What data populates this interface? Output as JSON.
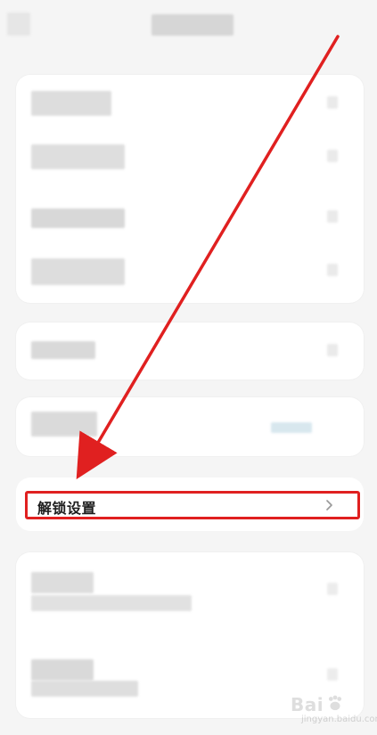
{
  "unlock_settings": {
    "label": "解锁设置"
  },
  "watermark": {
    "brand": "Bai",
    "site": "jingyan.baidu.com"
  },
  "icons": {
    "chevron": "chevron-right-icon",
    "annotation": "red-arrow-icon"
  },
  "colors": {
    "page_bg": "#f5f5f5",
    "card_bg": "#ffffff",
    "annotation_red": "#e02020",
    "text_primary": "#1e1e1e",
    "chevron_gray": "#9a9a9a"
  }
}
